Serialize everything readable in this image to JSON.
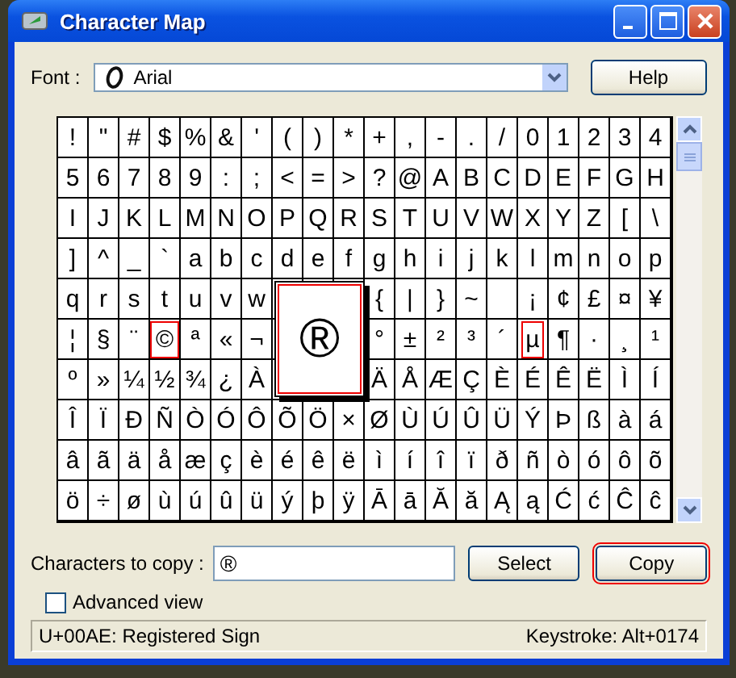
{
  "window": {
    "title": "Character Map"
  },
  "font": {
    "label": "Font :",
    "value": "Arial"
  },
  "help_button": "Help",
  "grid": {
    "rows": [
      [
        {
          "c": "!",
          "boxed": false
        },
        {
          "c": "\"",
          "boxed": false
        },
        {
          "c": "#",
          "boxed": false
        },
        {
          "c": "$",
          "boxed": false
        },
        {
          "c": "%",
          "boxed": false
        },
        {
          "c": "&",
          "boxed": false
        },
        {
          "c": "'",
          "boxed": false
        },
        {
          "c": "(",
          "boxed": false
        },
        {
          "c": ")",
          "boxed": false
        },
        {
          "c": "*",
          "boxed": false
        },
        {
          "c": "+",
          "boxed": false
        },
        {
          "c": ",",
          "boxed": false
        },
        {
          "c": "-",
          "boxed": false
        },
        {
          "c": ".",
          "boxed": false
        },
        {
          "c": "/",
          "boxed": false
        },
        {
          "c": "0",
          "boxed": false
        },
        {
          "c": "1",
          "boxed": false
        },
        {
          "c": "2",
          "boxed": false
        },
        {
          "c": "3",
          "boxed": false
        },
        {
          "c": "4",
          "boxed": false
        }
      ],
      [
        {
          "c": "5",
          "boxed": false
        },
        {
          "c": "6",
          "boxed": false
        },
        {
          "c": "7",
          "boxed": false
        },
        {
          "c": "8",
          "boxed": false
        },
        {
          "c": "9",
          "boxed": false
        },
        {
          "c": ":",
          "boxed": false
        },
        {
          "c": ";",
          "boxed": false
        },
        {
          "c": "<",
          "boxed": false
        },
        {
          "c": "=",
          "boxed": false
        },
        {
          "c": ">",
          "boxed": false
        },
        {
          "c": "?",
          "boxed": false
        },
        {
          "c": "@",
          "boxed": false
        },
        {
          "c": "A",
          "boxed": false
        },
        {
          "c": "B",
          "boxed": false
        },
        {
          "c": "C",
          "boxed": false
        },
        {
          "c": "D",
          "boxed": false
        },
        {
          "c": "E",
          "boxed": false
        },
        {
          "c": "F",
          "boxed": false
        },
        {
          "c": "G",
          "boxed": false
        },
        {
          "c": "H",
          "boxed": false
        }
      ],
      [
        {
          "c": "I",
          "boxed": false
        },
        {
          "c": "J",
          "boxed": false
        },
        {
          "c": "K",
          "boxed": false
        },
        {
          "c": "L",
          "boxed": false
        },
        {
          "c": "M",
          "boxed": false
        },
        {
          "c": "N",
          "boxed": false
        },
        {
          "c": "O",
          "boxed": false
        },
        {
          "c": "P",
          "boxed": false
        },
        {
          "c": "Q",
          "boxed": false
        },
        {
          "c": "R",
          "boxed": false
        },
        {
          "c": "S",
          "boxed": false
        },
        {
          "c": "T",
          "boxed": false
        },
        {
          "c": "U",
          "boxed": false
        },
        {
          "c": "V",
          "boxed": false
        },
        {
          "c": "W",
          "boxed": false
        },
        {
          "c": "X",
          "boxed": false
        },
        {
          "c": "Y",
          "boxed": false
        },
        {
          "c": "Z",
          "boxed": false
        },
        {
          "c": "[",
          "boxed": false
        },
        {
          "c": "\\",
          "boxed": false
        }
      ],
      [
        {
          "c": "]",
          "boxed": false
        },
        {
          "c": "^",
          "boxed": false
        },
        {
          "c": "_",
          "boxed": false
        },
        {
          "c": "`",
          "boxed": false
        },
        {
          "c": "a",
          "boxed": false
        },
        {
          "c": "b",
          "boxed": false
        },
        {
          "c": "c",
          "boxed": false
        },
        {
          "c": "d",
          "boxed": false
        },
        {
          "c": "e",
          "boxed": false
        },
        {
          "c": "f",
          "boxed": false
        },
        {
          "c": "g",
          "boxed": false
        },
        {
          "c": "h",
          "boxed": false
        },
        {
          "c": "i",
          "boxed": false
        },
        {
          "c": "j",
          "boxed": false
        },
        {
          "c": "k",
          "boxed": false
        },
        {
          "c": "l",
          "boxed": false
        },
        {
          "c": "m",
          "boxed": false
        },
        {
          "c": "n",
          "boxed": false
        },
        {
          "c": "o",
          "boxed": false
        },
        {
          "c": "p",
          "boxed": false
        }
      ],
      [
        {
          "c": "q",
          "boxed": false
        },
        {
          "c": "r",
          "boxed": false
        },
        {
          "c": "s",
          "boxed": false
        },
        {
          "c": "t",
          "boxed": false
        },
        {
          "c": "u",
          "boxed": false
        },
        {
          "c": "v",
          "boxed": false
        },
        {
          "c": "w",
          "boxed": false
        },
        null,
        null,
        null,
        {
          "c": "{",
          "boxed": false
        },
        {
          "c": "|",
          "boxed": false
        },
        {
          "c": "}",
          "boxed": false
        },
        {
          "c": "~",
          "boxed": false
        },
        null,
        {
          "c": "¡",
          "boxed": false
        },
        {
          "c": "¢",
          "boxed": false
        },
        {
          "c": "£",
          "boxed": false
        },
        {
          "c": "¤",
          "boxed": false
        },
        {
          "c": "¥",
          "boxed": false
        }
      ],
      [
        {
          "c": "¦",
          "boxed": false
        },
        {
          "c": "§",
          "boxed": false
        },
        {
          "c": "¨",
          "boxed": false
        },
        {
          "c": "©",
          "boxed": true
        },
        {
          "c": "ª",
          "boxed": false
        },
        {
          "c": "«",
          "boxed": false
        },
        {
          "c": "¬",
          "boxed": false
        },
        null,
        null,
        null,
        {
          "c": "°",
          "boxed": false
        },
        {
          "c": "±",
          "boxed": false
        },
        {
          "c": "²",
          "boxed": false
        },
        {
          "c": "³",
          "boxed": false
        },
        {
          "c": "´",
          "boxed": false
        },
        {
          "c": "µ",
          "boxed": true
        },
        {
          "c": "¶",
          "boxed": false
        },
        {
          "c": "·",
          "boxed": false
        },
        {
          "c": "¸",
          "boxed": false
        },
        {
          "c": "¹",
          "boxed": false
        }
      ],
      [
        {
          "c": "º",
          "boxed": false
        },
        {
          "c": "»",
          "boxed": false
        },
        {
          "c": "¼",
          "boxed": false
        },
        {
          "c": "½",
          "boxed": false
        },
        {
          "c": "¾",
          "boxed": false
        },
        {
          "c": "¿",
          "boxed": false
        },
        {
          "c": "À",
          "boxed": false
        },
        null,
        null,
        null,
        {
          "c": "Ä",
          "boxed": false
        },
        {
          "c": "Å",
          "boxed": false
        },
        {
          "c": "Æ",
          "boxed": false
        },
        {
          "c": "Ç",
          "boxed": false
        },
        {
          "c": "È",
          "boxed": false
        },
        {
          "c": "É",
          "boxed": false
        },
        {
          "c": "Ê",
          "boxed": false
        },
        {
          "c": "Ë",
          "boxed": false
        },
        {
          "c": "Ì",
          "boxed": false
        },
        {
          "c": "Í",
          "boxed": false
        }
      ],
      [
        {
          "c": "Î",
          "boxed": false
        },
        {
          "c": "Ï",
          "boxed": false
        },
        {
          "c": "Ð",
          "boxed": false
        },
        {
          "c": "Ñ",
          "boxed": false
        },
        {
          "c": "Ò",
          "boxed": false
        },
        {
          "c": "Ó",
          "boxed": false
        },
        {
          "c": "Ô",
          "boxed": false
        },
        {
          "c": "Õ",
          "boxed": false
        },
        {
          "c": "Ö",
          "boxed": false
        },
        {
          "c": "×",
          "boxed": false
        },
        {
          "c": "Ø",
          "boxed": false
        },
        {
          "c": "Ù",
          "boxed": false
        },
        {
          "c": "Ú",
          "boxed": false
        },
        {
          "c": "Û",
          "boxed": false
        },
        {
          "c": "Ü",
          "boxed": false
        },
        {
          "c": "Ý",
          "boxed": false
        },
        {
          "c": "Þ",
          "boxed": false
        },
        {
          "c": "ß",
          "boxed": false
        },
        {
          "c": "à",
          "boxed": false
        },
        {
          "c": "á",
          "boxed": false
        }
      ],
      [
        {
          "c": "â",
          "boxed": false
        },
        {
          "c": "ã",
          "boxed": false
        },
        {
          "c": "ä",
          "boxed": false
        },
        {
          "c": "å",
          "boxed": false
        },
        {
          "c": "æ",
          "boxed": false
        },
        {
          "c": "ç",
          "boxed": false
        },
        {
          "c": "è",
          "boxed": false
        },
        {
          "c": "é",
          "boxed": false
        },
        {
          "c": "ê",
          "boxed": false
        },
        {
          "c": "ë",
          "boxed": false
        },
        {
          "c": "ì",
          "boxed": false
        },
        {
          "c": "í",
          "boxed": false
        },
        {
          "c": "î",
          "boxed": false
        },
        {
          "c": "ï",
          "boxed": false
        },
        {
          "c": "ð",
          "boxed": false
        },
        {
          "c": "ñ",
          "boxed": false
        },
        {
          "c": "ò",
          "boxed": false
        },
        {
          "c": "ó",
          "boxed": false
        },
        {
          "c": "ô",
          "boxed": false
        },
        {
          "c": "õ",
          "boxed": false
        }
      ],
      [
        {
          "c": "ö",
          "boxed": false
        },
        {
          "c": "÷",
          "boxed": false
        },
        {
          "c": "ø",
          "boxed": false
        },
        {
          "c": "ù",
          "boxed": false
        },
        {
          "c": "ú",
          "boxed": false
        },
        {
          "c": "û",
          "boxed": false
        },
        {
          "c": "ü",
          "boxed": false
        },
        {
          "c": "ý",
          "boxed": false
        },
        {
          "c": "þ",
          "boxed": false
        },
        {
          "c": "ÿ",
          "boxed": false
        },
        {
          "c": "Ā",
          "boxed": false
        },
        {
          "c": "ā",
          "boxed": false
        },
        {
          "c": "Ă",
          "boxed": false
        },
        {
          "c": "ă",
          "boxed": false
        },
        {
          "c": "Ą",
          "boxed": false
        },
        {
          "c": "ą",
          "boxed": false
        },
        {
          "c": "Ć",
          "boxed": false
        },
        {
          "c": "ć",
          "boxed": false
        },
        {
          "c": "Ĉ",
          "boxed": false
        },
        {
          "c": "ĉ",
          "boxed": false
        }
      ]
    ],
    "magnified": {
      "char": "®",
      "boxed": true
    }
  },
  "copy": {
    "label": "Characters to copy :",
    "value": "®"
  },
  "select_button": {
    "label": "Select",
    "boxed": false
  },
  "copy_button": {
    "label": "Copy",
    "boxed": true
  },
  "advanced_view": {
    "label": "Advanced view",
    "checked": false
  },
  "status_bar": {
    "info": "U+00AE: Registered Sign",
    "keystroke": "Keystroke: Alt+0174"
  }
}
